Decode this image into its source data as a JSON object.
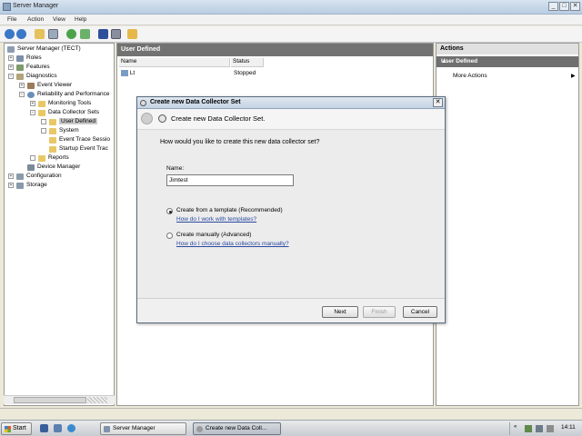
{
  "window": {
    "title": "Server Manager",
    "controls": {
      "minimize": "_",
      "maximize": "□",
      "close": "✕"
    }
  },
  "menu": [
    "File",
    "Action",
    "View",
    "Help"
  ],
  "toolbar_icons": [
    "back-icon",
    "forward-icon",
    "up-folder-icon",
    "show-hide-tree-icon",
    "refresh-icon",
    "export-icon",
    "help-icon",
    "properties-icon",
    "new-icon"
  ],
  "tree": {
    "items": [
      {
        "label": "Server Manager (TECT)",
        "icon": "server-icon"
      },
      {
        "label": "Roles",
        "icon": "roles-icon"
      },
      {
        "label": "Features",
        "icon": "features-icon"
      },
      {
        "label": "Diagnostics",
        "icon": "diagnostics-icon"
      },
      {
        "label": "Event Viewer",
        "icon": "event-viewer-icon"
      },
      {
        "label": "Reliability and Performance",
        "icon": "performance-icon"
      },
      {
        "label": "Monitoring Tools",
        "icon": "folder-icon"
      },
      {
        "label": "Data Collector Sets",
        "icon": "folder-icon"
      },
      {
        "label": "User Defined",
        "icon": "folder-icon"
      },
      {
        "label": "System",
        "icon": "folder-icon"
      },
      {
        "label": "Event Trace Sessio",
        "icon": "folder-icon"
      },
      {
        "label": "Startup Event Trac",
        "icon": "folder-icon"
      },
      {
        "label": "Reports",
        "icon": "folder-icon"
      },
      {
        "label": "Device Manager",
        "icon": "device-manager-icon"
      },
      {
        "label": "Configuration",
        "icon": "configuration-icon"
      },
      {
        "label": "Storage",
        "icon": "storage-icon"
      }
    ]
  },
  "center": {
    "header": "User Defined",
    "columns": [
      "Name",
      "Status"
    ],
    "rows": [
      {
        "name": "Lt",
        "status": "Stopped"
      }
    ]
  },
  "actions": {
    "header": "Actions",
    "section": "User Defined",
    "section_chevron": "▲",
    "items": [
      {
        "label": "More Actions",
        "arrow": "▶"
      }
    ]
  },
  "dialog": {
    "title": "Create new Data Collector Set",
    "close": "✕",
    "wizard_title": "Create new Data Collector Set.",
    "question": "How would you like to create this new data collector set?",
    "name_label": "Name:",
    "name_value": "Jimtest",
    "options": [
      {
        "label": "Create from a template (Recommended)",
        "link": "How do I work with templates?",
        "selected": true
      },
      {
        "label": "Create manually (Advanced)",
        "link": "How do I choose data collectors manually?",
        "selected": false
      }
    ],
    "buttons": {
      "next": "Next",
      "finish": "Finish",
      "cancel": "Cancel"
    }
  },
  "taskbar": {
    "start": "Start",
    "tasks": [
      {
        "label": "Server Manager",
        "active": false
      },
      {
        "label": "Create new Data Coll...",
        "active": true
      }
    ],
    "clock": "14:11"
  }
}
